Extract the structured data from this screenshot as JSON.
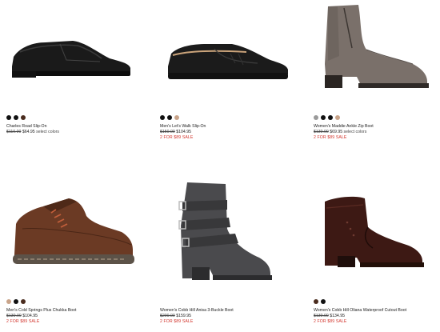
{
  "products": [
    {
      "name": "Charles Road Slip-On",
      "was": "$110.00",
      "now": "$64.95",
      "note": "select colors",
      "sale": "",
      "swatches": [
        "#111111",
        "#111111",
        "#4a2c1e"
      ],
      "image": "black-slip-on-loafer-icon"
    },
    {
      "name": "Men's Let's Walk Slip-On",
      "was": "$150.00",
      "now": "$104.95",
      "note": "",
      "sale": "2 FOR $89 SALE",
      "swatches": [
        "#111111",
        "#111111",
        "#c9a48a"
      ],
      "image": "black-walking-slip-on-icon"
    },
    {
      "name": "Women's Maddie Ankle Zip Boot",
      "was": "$130.00",
      "now": "$69.95",
      "note": "select colors",
      "sale": "2 FOR $89 SALE",
      "swatches": [
        "#9a9a9a",
        "#111111",
        "#111111",
        "#c9a48a"
      ],
      "image": "grey-ankle-zip-boot-icon"
    },
    {
      "name": "Men's Cold Springs Plus Chukka Boot",
      "was": "$130.00",
      "now": "$104.95",
      "note": "",
      "sale": "2 FOR $89 SALE",
      "swatches": [
        "#c9a48a",
        "#111111",
        "#4a2c1e"
      ],
      "image": "brown-chukka-boot-icon"
    },
    {
      "name": "Women's Cobb Hill Anisa 3-Buckle Boot",
      "was": "$200.00",
      "now": "$159.95",
      "note": "",
      "sale": "2 FOR $89 SALE",
      "swatches": [],
      "image": "grey-buckle-boot-icon"
    },
    {
      "name": "Women's Cobb Hill Oliana Waterproof Cutout Boot",
      "was": "$130.00",
      "now": "$134.95",
      "note": "",
      "sale": "2 FOR $89 SALE",
      "swatches": [
        "#4a2c1e",
        "#111111"
      ],
      "image": "burgundy-cutout-boot-icon"
    }
  ]
}
